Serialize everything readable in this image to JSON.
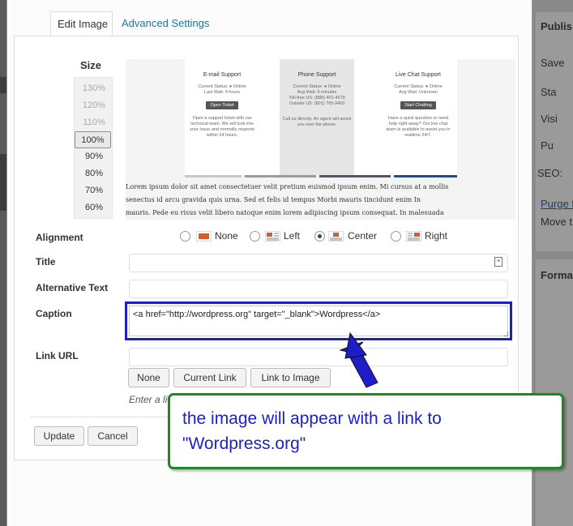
{
  "tabs": [
    {
      "label": "Edit Image",
      "active": true
    },
    {
      "label": "Advanced Settings",
      "active": false
    }
  ],
  "size": {
    "label": "Size",
    "options": [
      "130%",
      "120%",
      "110%",
      "100%",
      "90%",
      "80%",
      "70%",
      "60%"
    ],
    "selected": "100%"
  },
  "preview": {
    "columns": [
      {
        "heading": "E-mail Support",
        "lines": [
          "Current Status: ● Online",
          "Last Wait: 4 hours"
        ],
        "button": "Open Ticket",
        "para": "Open a support ticket with our technical team. We will look into your issue and normally respond within 24 hours."
      },
      {
        "heading": "Phone Support",
        "lines": [
          "Current Status: ● Online",
          "Avg Wait: 5 minutes",
          "Toll-free US: (888) 401-4678",
          "Outside US: (801) 765-9400"
        ],
        "button": "",
        "para": "Call us directly. An agent will assist you over the phone."
      },
      {
        "heading": "Live Chat Support",
        "lines": [
          "Current Status: ● Online",
          "Avg Wait: Unknown"
        ],
        "button": "Start Chatting",
        "para": "Have a quick question or need help right away? Our live chat team is available to assist you in realtime 24/7."
      }
    ],
    "bar_colors": [
      "#c8c8c8",
      "#9a9a9a",
      "#555566",
      "#2c4a7a"
    ],
    "lorem": [
      "Lorem ipsum dolor sit amet consectetuer velit pretium euismod ipsum enim. Mi cursus at a mollis",
      "senectus id arcu gravida quis urna. Sed et felis id tempus Morbi mauris tincidunt enim In",
      "mauris. Pede eu risus velit libero natoque enim lorem adipiscing ipsum consequat. In malesuada"
    ]
  },
  "fields": {
    "alignment_label": "Alignment",
    "alignment_options": [
      {
        "label": "None",
        "selected": false
      },
      {
        "label": "Left",
        "selected": false
      },
      {
        "label": "Center",
        "selected": true
      },
      {
        "label": "Right",
        "selected": false
      }
    ],
    "title_label": "Title",
    "title_value": "",
    "alt_label": "Alternative Text",
    "alt_value": "",
    "caption_label": "Caption",
    "caption_value": "<a href=\"http://wordpress.org\" target=\"_blank\">Wordpress</a>",
    "link_label": "Link URL",
    "link_value": "",
    "link_buttons": [
      "None",
      "Current Link",
      "Link to Image"
    ],
    "link_hint": "Enter a li"
  },
  "actions": {
    "update": "Update",
    "cancel": "Cancel"
  },
  "callout": {
    "text_line1": "the image will appear with a link to",
    "text_line2": "\"Wordpress.org\"",
    "border_color": "#1e8a1e",
    "text_color": "#1e1ec8"
  },
  "background": {
    "items": [
      "Publis",
      "Save",
      "Sta",
      "Visi",
      "Pu",
      "SEO:",
      "Purge f",
      "Move t",
      "Forma"
    ]
  }
}
